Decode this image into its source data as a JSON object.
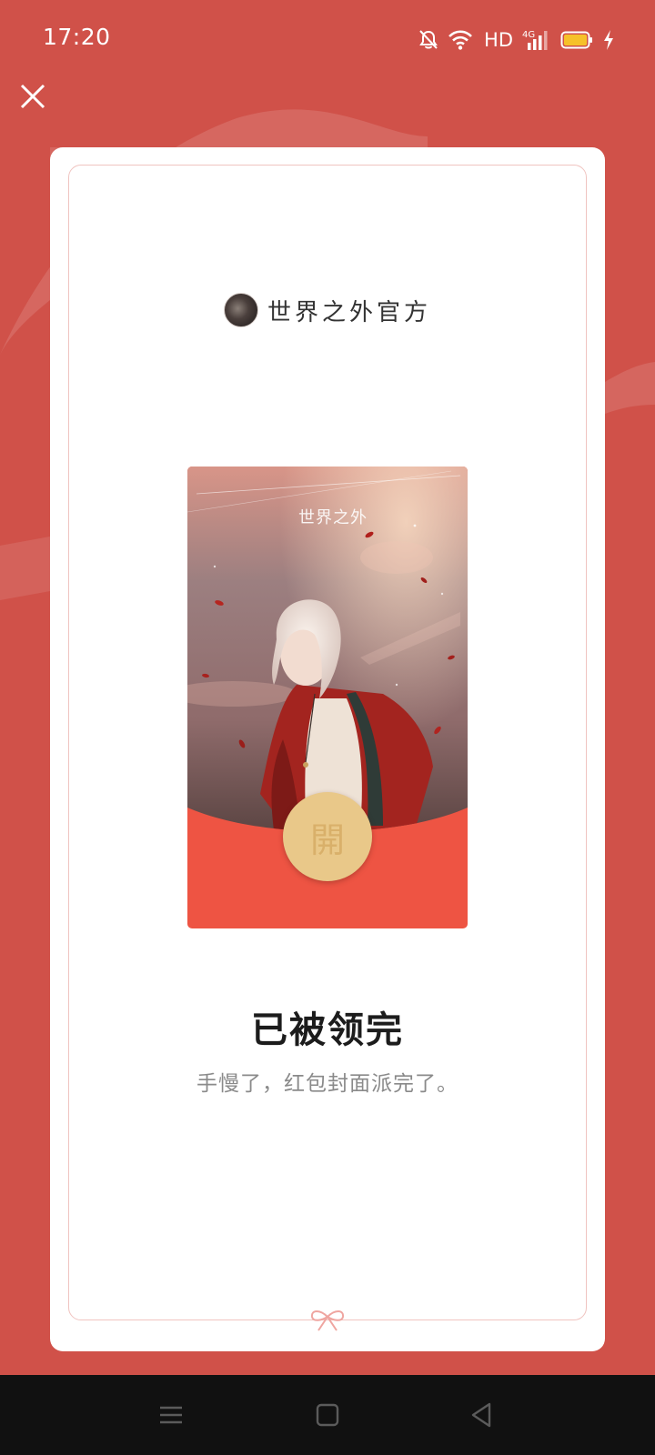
{
  "status_bar": {
    "time": "17:20",
    "network_label": "HD",
    "icons": [
      "mute-bell-icon",
      "wifi-icon",
      "4g-signal-icon",
      "battery-icon",
      "charging-icon"
    ]
  },
  "header": {
    "close_icon": "close-icon"
  },
  "sender": {
    "name": "世界之外官方"
  },
  "envelope": {
    "logo_text": "世界之外",
    "open_label": "開"
  },
  "result": {
    "title": "已被领完",
    "subtitle": "手慢了，红包封面派完了。"
  },
  "nav": {
    "icons": [
      "menu-icon",
      "home-icon",
      "back-icon"
    ]
  },
  "colors": {
    "background": "#D05149",
    "envelope_red": "#EE5443",
    "coin_gold": "#E9C889"
  }
}
